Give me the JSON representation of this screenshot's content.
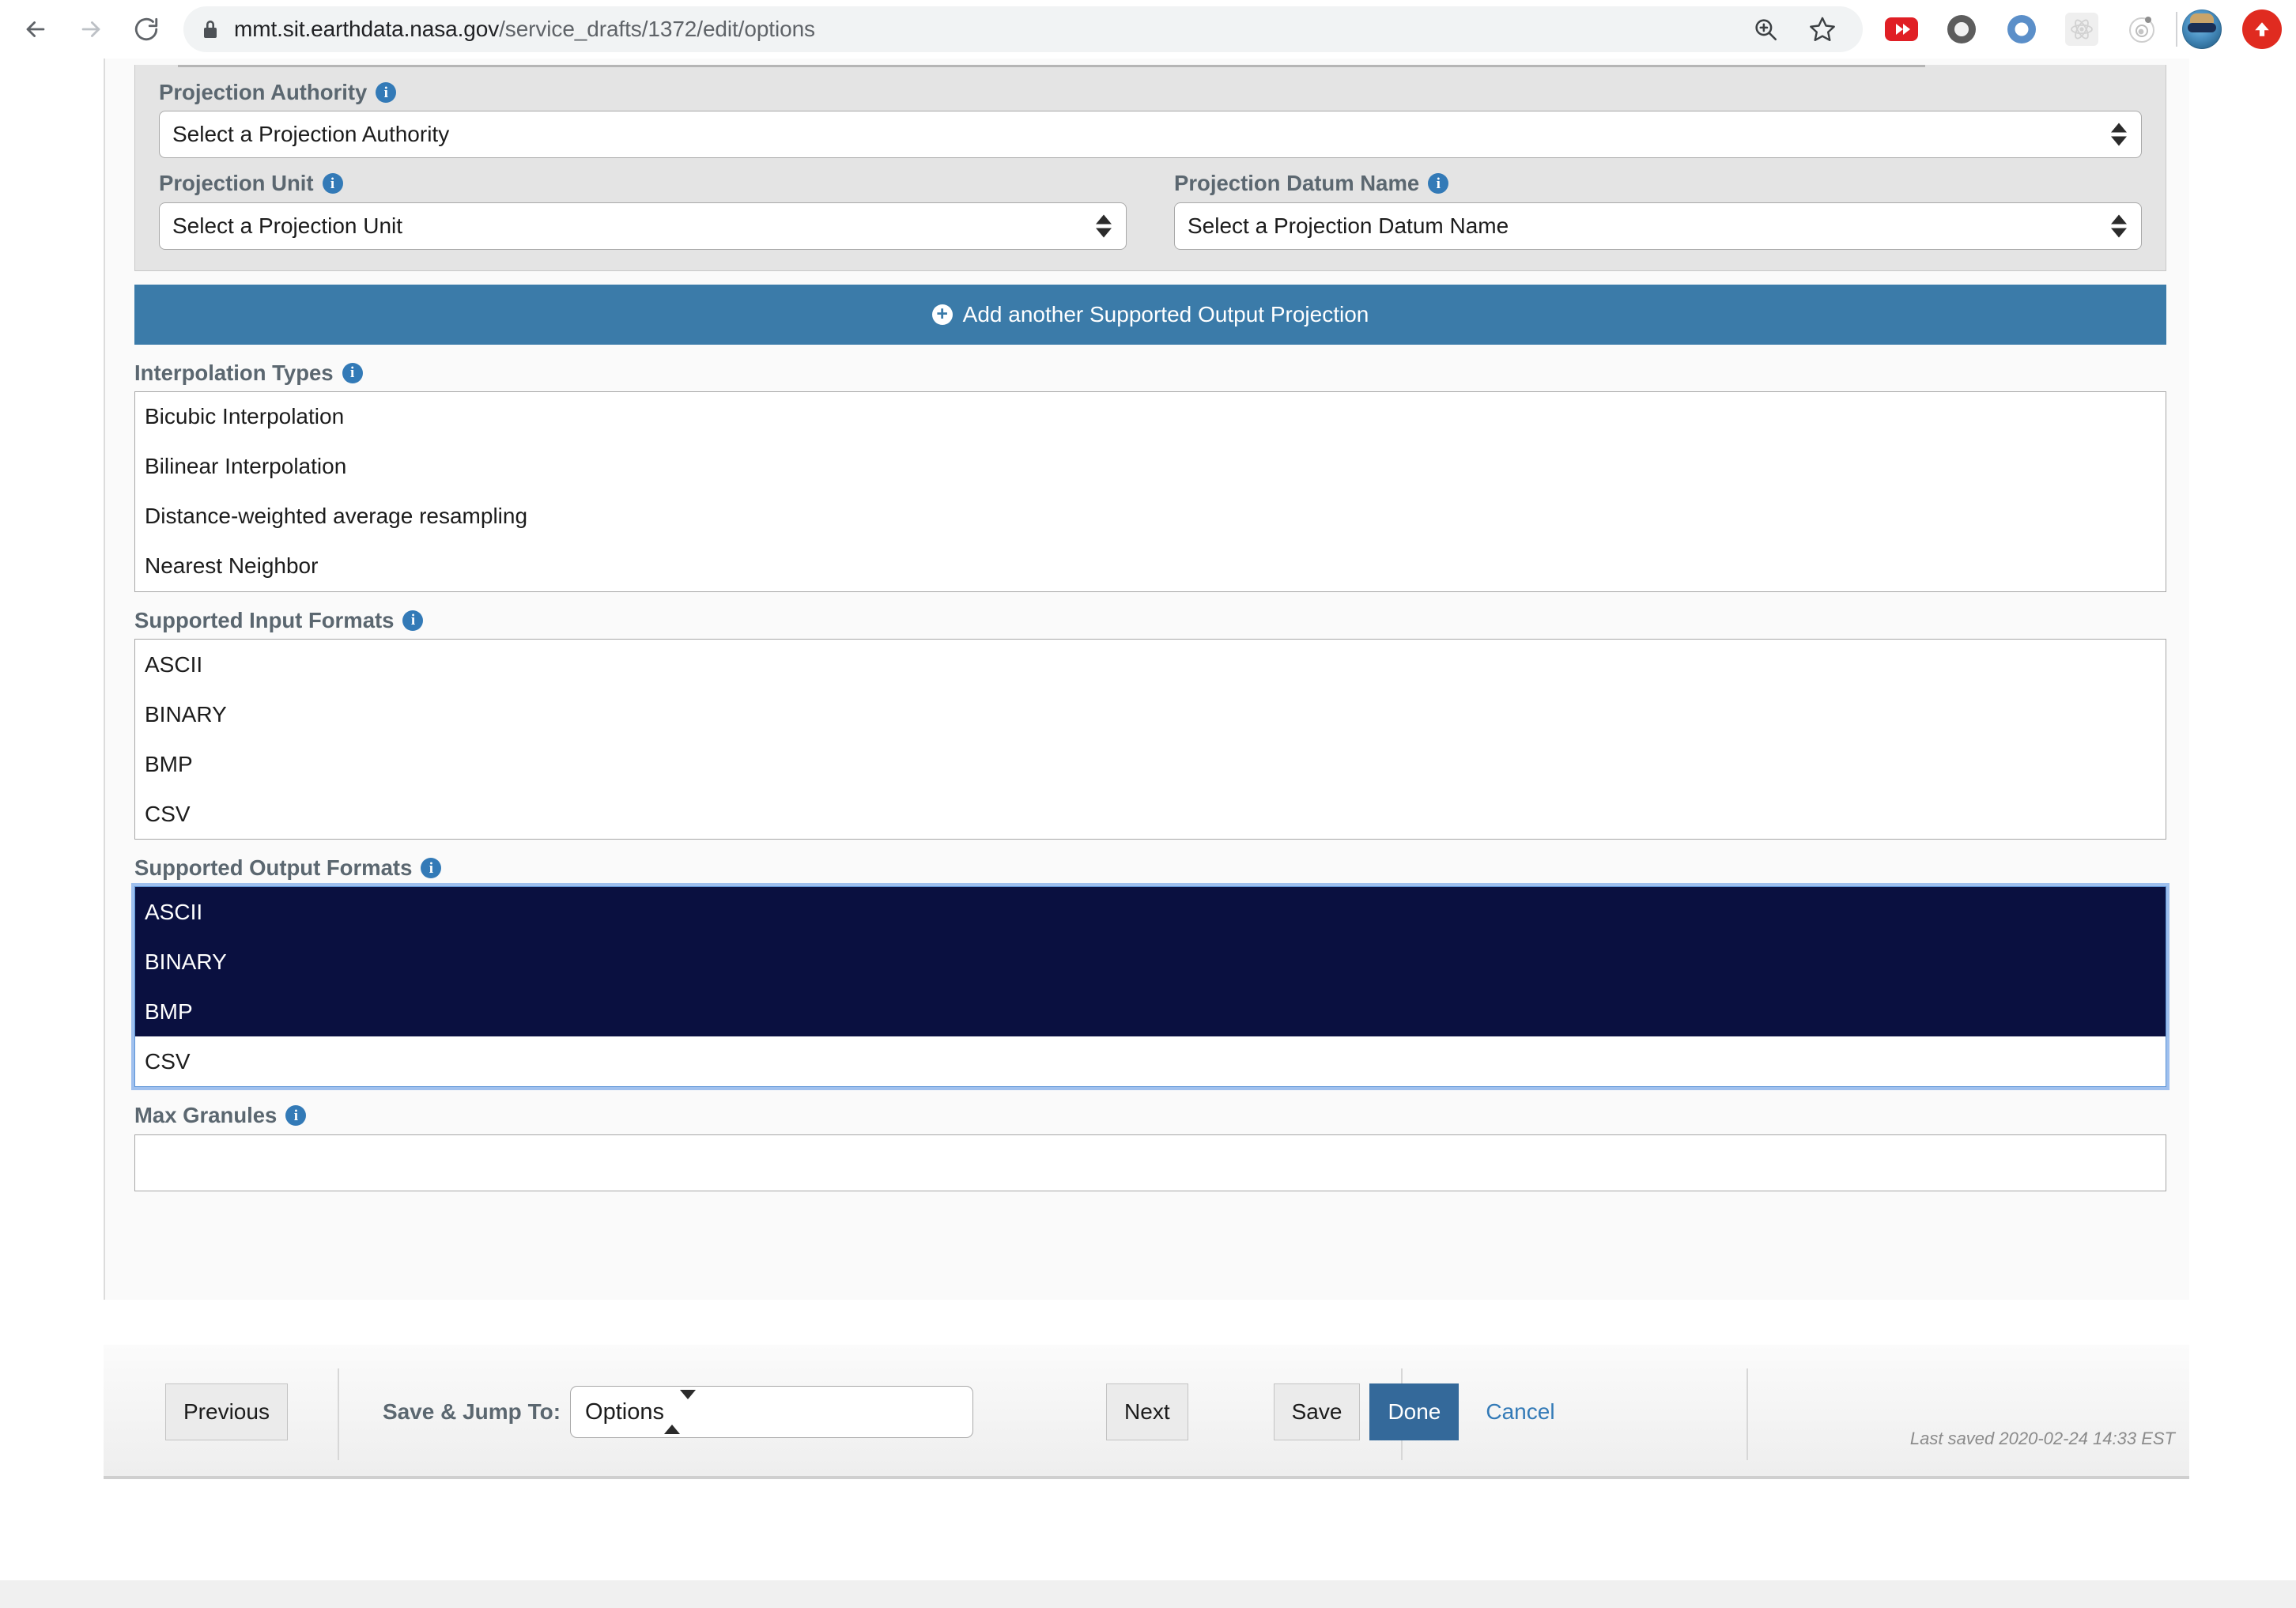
{
  "browser": {
    "url_host": "mmt.sit.earthdata.nasa.gov",
    "url_path": "/service_drafts/1372/edit/options",
    "back_icon": "back-arrow-icon",
    "forward_icon": "forward-arrow-icon",
    "reload_icon": "reload-icon",
    "lock_icon": "lock-icon",
    "zoom_icon": "zoom-in-icon",
    "bookmark_icon": "star-icon",
    "extensions": [
      "youtube-extension-icon",
      "grey-ring-extension-icon",
      "blue-ring-extension-icon",
      "react-devtools-icon",
      "orbit-extension-icon"
    ],
    "profile_icon": "profile-avatar",
    "update_icon": "update-arrow-icon"
  },
  "projection": {
    "authority": {
      "label": "Projection Authority",
      "info_icon": "info-icon",
      "value": "Select a Projection Authority"
    },
    "unit": {
      "label": "Projection Unit",
      "info_icon": "info-icon",
      "value": "Select a Projection Unit"
    },
    "datum": {
      "label": "Projection Datum Name",
      "info_icon": "info-icon",
      "value": "Select a Projection Datum Name"
    },
    "add_button": {
      "label": "Add another Supported Output Projection",
      "icon": "plus-circle-icon"
    }
  },
  "interpolation": {
    "label": "Interpolation Types",
    "info_icon": "info-icon",
    "options": [
      {
        "label": "Bicubic Interpolation",
        "selected": false
      },
      {
        "label": "Bilinear Interpolation",
        "selected": false
      },
      {
        "label": "Distance-weighted average resampling",
        "selected": false
      },
      {
        "label": "Nearest Neighbor",
        "selected": false
      }
    ]
  },
  "input_formats": {
    "label": "Supported Input Formats",
    "info_icon": "info-icon",
    "options": [
      {
        "label": "ASCII",
        "selected": false
      },
      {
        "label": "BINARY",
        "selected": false
      },
      {
        "label": "BMP",
        "selected": false
      },
      {
        "label": "CSV",
        "selected": false
      }
    ]
  },
  "output_formats": {
    "label": "Supported Output Formats",
    "info_icon": "info-icon",
    "focused": true,
    "options": [
      {
        "label": "ASCII",
        "selected": true
      },
      {
        "label": "BINARY",
        "selected": true
      },
      {
        "label": "BMP",
        "selected": true
      },
      {
        "label": "CSV",
        "selected": false
      }
    ]
  },
  "max_granules": {
    "label": "Max Granules",
    "info_icon": "info-icon",
    "value": "",
    "placeholder": ""
  },
  "footer": {
    "previous_label": "Previous",
    "jump_label": "Save & Jump To:",
    "jump_value": "Options",
    "next_label": "Next",
    "save_label": "Save",
    "done_label": "Done",
    "cancel_label": "Cancel",
    "last_saved": "Last saved 2020-02-24 14:33 EST"
  },
  "colors": {
    "accent_blue": "#3b7ba9",
    "primary_button": "#34699a",
    "link_blue": "#337ab7",
    "selection_navy": "#0a1040",
    "label_gray": "#5b6770"
  }
}
